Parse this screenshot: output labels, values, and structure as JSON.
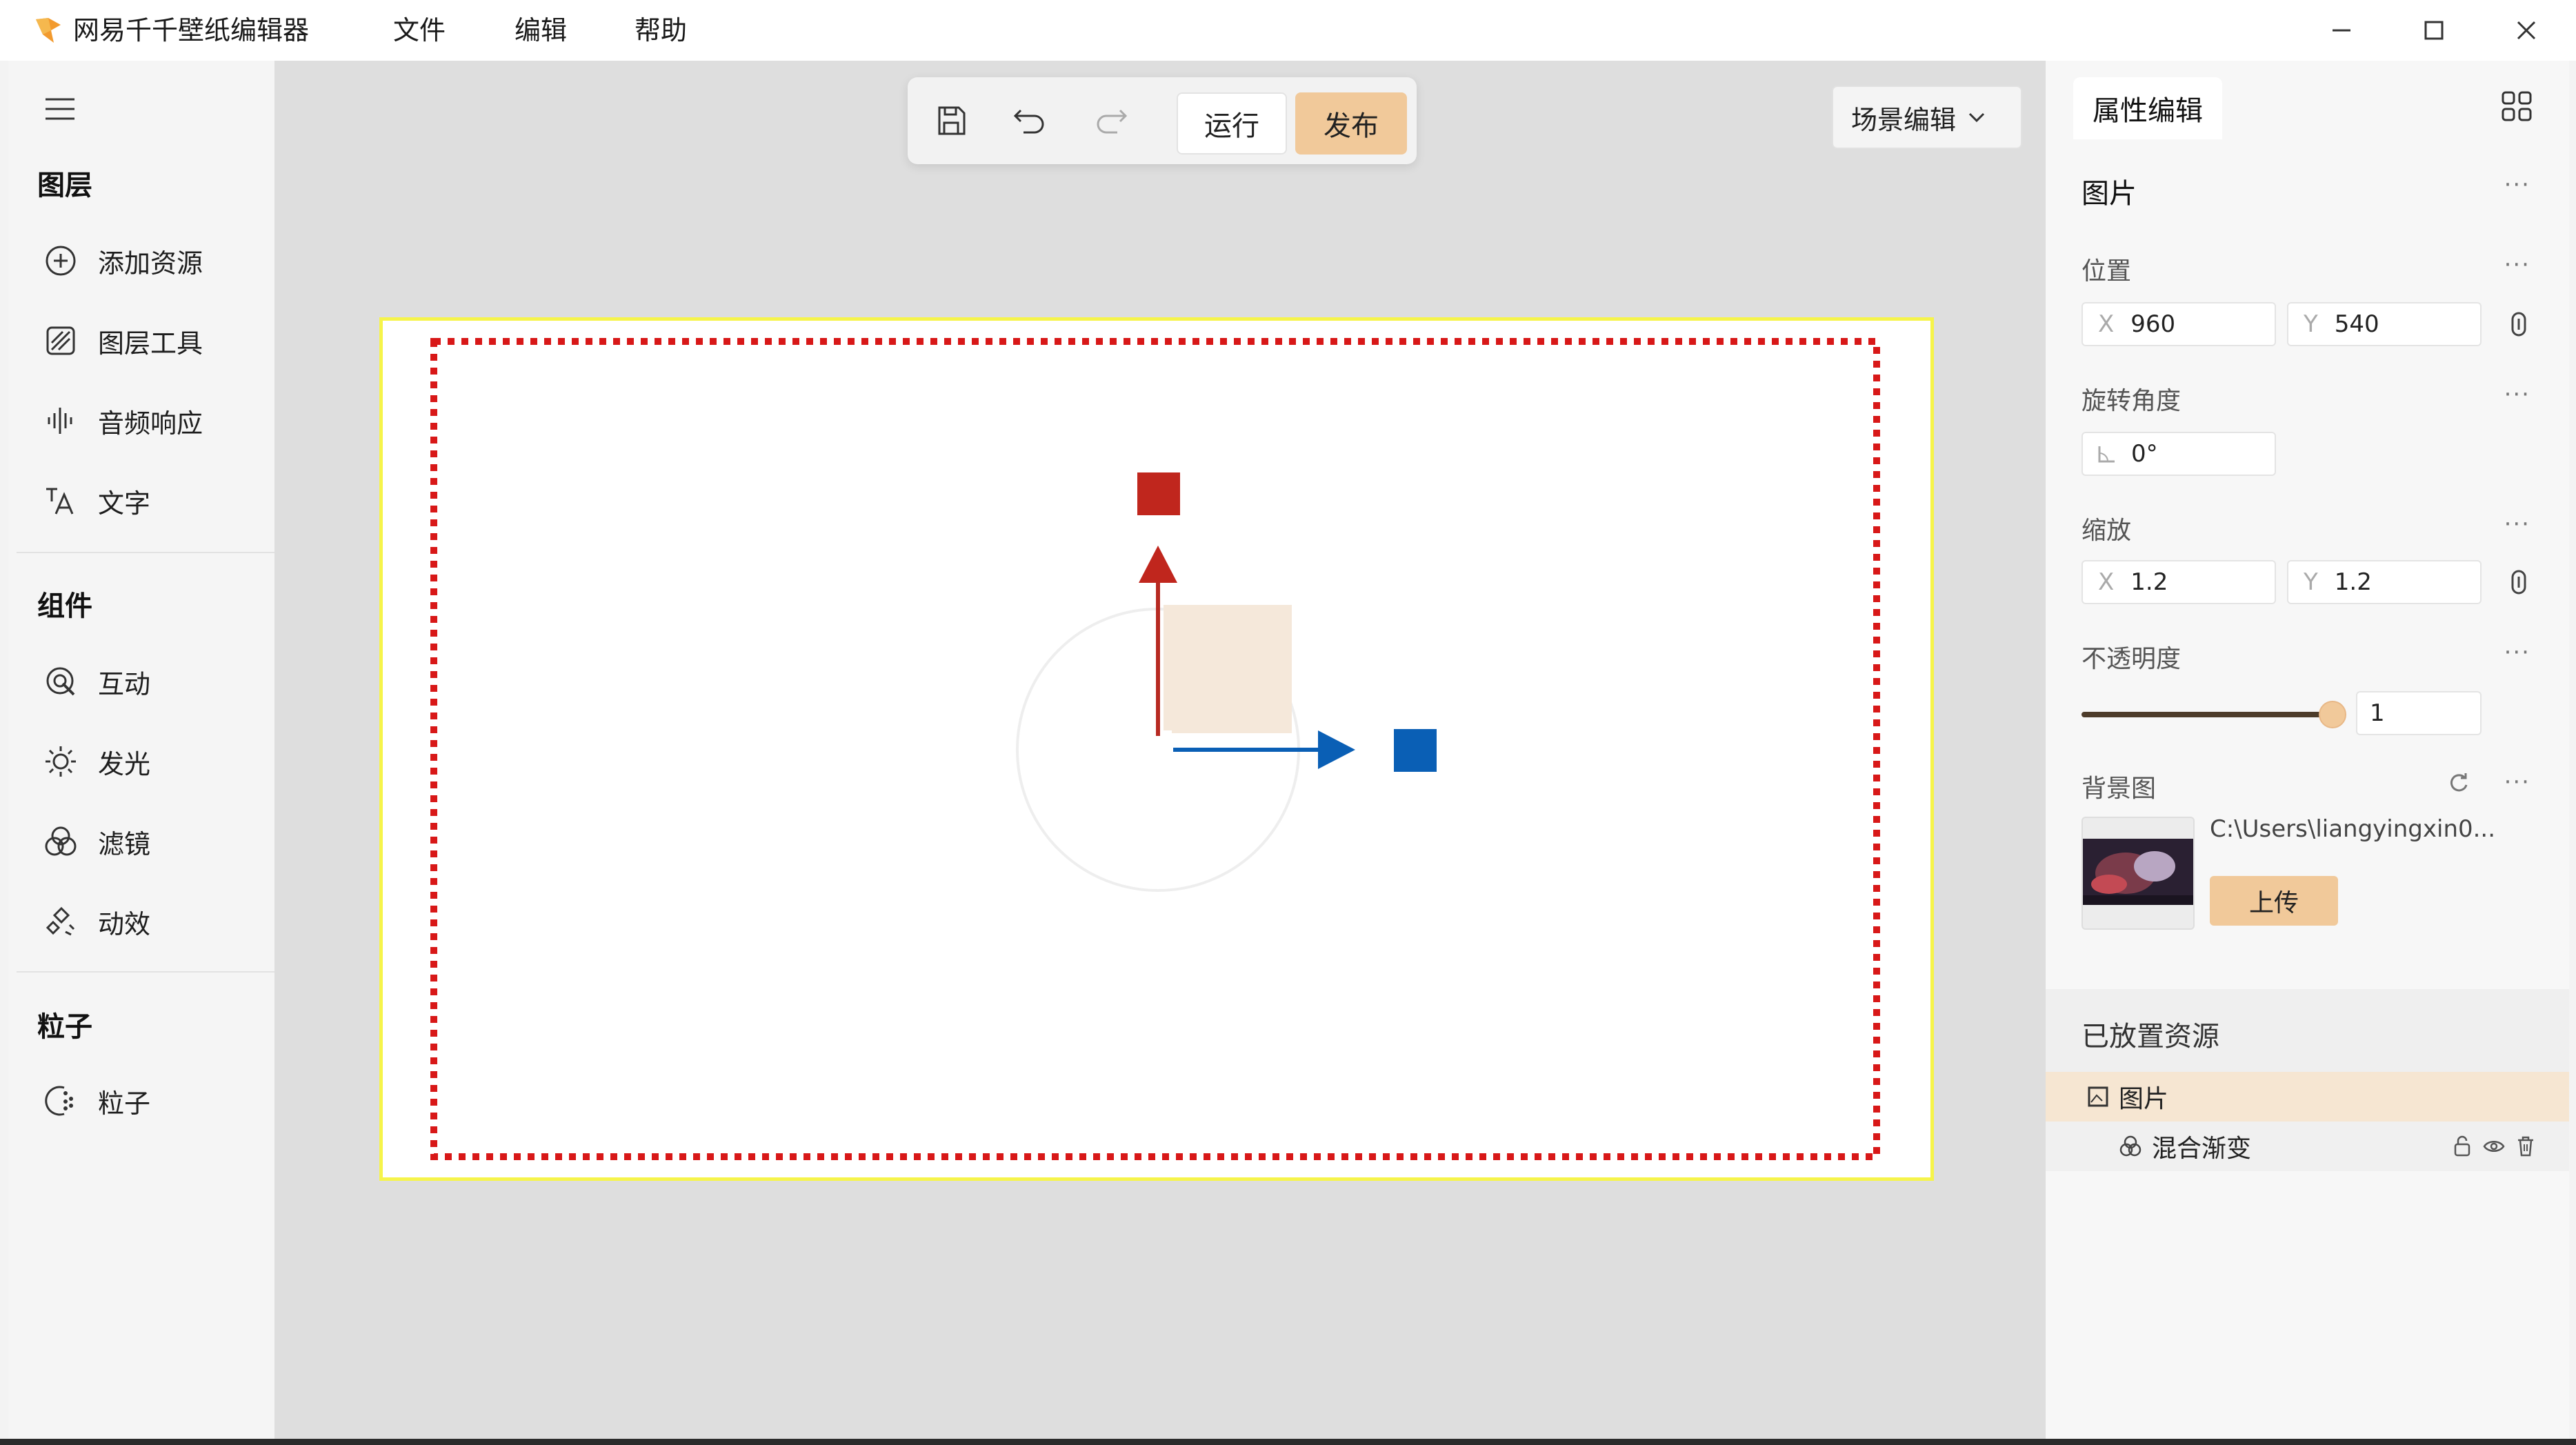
{
  "app": {
    "title": "网易千千壁纸编辑器",
    "menu": [
      "文件",
      "编辑",
      "帮助"
    ]
  },
  "left_panel": {
    "sections": [
      {
        "title": "图层",
        "items": [
          {
            "label": "添加资源",
            "icon": "plus-circle-icon"
          },
          {
            "label": "图层工具",
            "icon": "layer-tool-icon"
          },
          {
            "label": "音频响应",
            "icon": "audio-wave-icon"
          },
          {
            "label": "文字",
            "icon": "text-icon"
          }
        ]
      },
      {
        "title": "组件",
        "items": [
          {
            "label": "互动",
            "icon": "interaction-icon"
          },
          {
            "label": "发光",
            "icon": "glow-icon"
          },
          {
            "label": "滤镜",
            "icon": "filter-icon"
          },
          {
            "label": "动效",
            "icon": "animation-icon"
          }
        ]
      },
      {
        "title": "粒子",
        "items": [
          {
            "label": "粒子",
            "icon": "particle-icon"
          }
        ]
      }
    ]
  },
  "toolbar": {
    "run_label": "运行",
    "publish_label": "发布",
    "scene_mode": "场景编辑"
  },
  "properties": {
    "tab": "属性编辑",
    "object_name": "图片",
    "position": {
      "label": "位置",
      "x": "960",
      "y": "540"
    },
    "rotation": {
      "label": "旋转角度",
      "value": "0°"
    },
    "scale": {
      "label": "缩放",
      "x": "1.2",
      "y": "1.2"
    },
    "opacity": {
      "label": "不透明度",
      "value": "1",
      "level": 1.0
    },
    "background": {
      "label": "背景图",
      "path": "C:\\Users\\liangyingxin0...",
      "upload": "上传"
    },
    "axis_x": "X",
    "axis_y": "Y",
    "more": "···"
  },
  "placed_resources": {
    "title": "已放置资源",
    "items": [
      {
        "label": "图片",
        "selected": true
      },
      {
        "label": "混合渐变",
        "selected": false
      }
    ]
  },
  "colors": {
    "accent": "#f1c99a",
    "gizmo_y": "#c0261d",
    "gizmo_x": "#0a5fb5",
    "stage_border": "#f6f44a",
    "safe_frame": "#d81818"
  }
}
